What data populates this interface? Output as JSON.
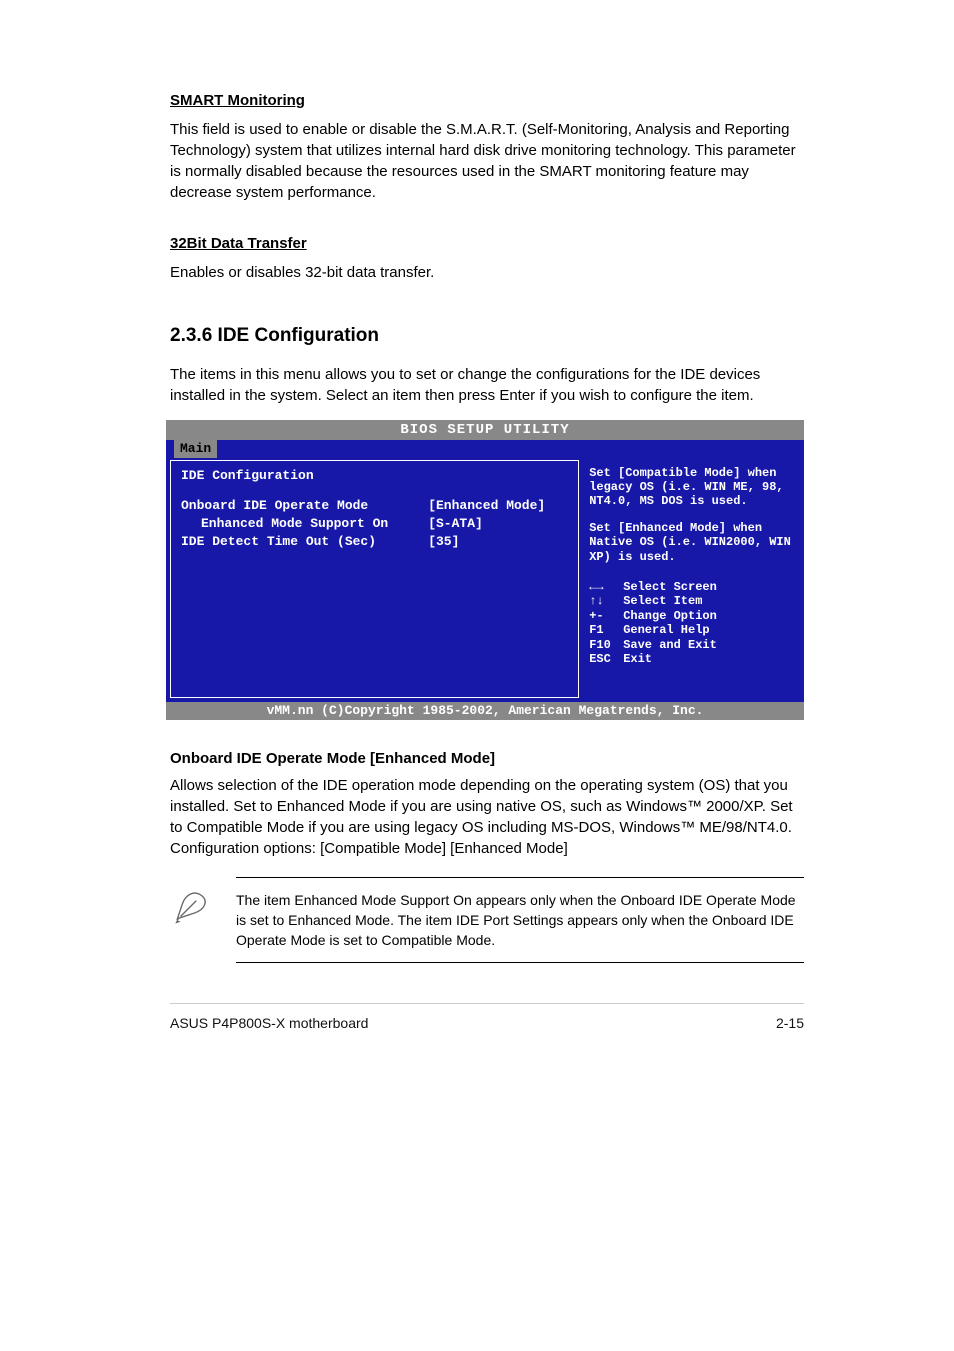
{
  "sections": {
    "smart": {
      "heading": "SMART Monitoring",
      "body": "This field is used to enable or disable the S.M.A.R.T. (Self-Monitoring, Analysis and Reporting Technology) system that utilizes internal hard disk drive monitoring technology. This parameter is normally disabled because the resources used in the SMART monitoring feature may decrease system performance."
    },
    "transfer": {
      "heading": "32Bit Data Transfer",
      "body": "Enables or disables 32-bit data transfer."
    },
    "ide_conf": {
      "title": "2.3.6 IDE Configuration",
      "intro": "The items in this menu allows you to set or change the configurations for the IDE devices installed in the system. Select an item then press Enter if you wish to configure the item."
    },
    "opmode": {
      "heading": "Onboard IDE Operate Mode [Enhanced Mode]",
      "body": "Allows selection of the IDE operation mode depending on the operating system (OS) that you installed. Set to Enhanced Mode if you are using native OS, such as Windows™ 2000/XP. Set to Compatible Mode if you are using legacy OS including MS-DOS, Windows™ ME/98/NT4.0. Configuration options: [Compatible Mode] [Enhanced Mode]"
    }
  },
  "bios": {
    "top": "BIOS SETUP UTILITY",
    "menubar": {
      "active": "Main"
    },
    "left_title": "IDE Configuration",
    "rows": {
      "r1": {
        "label": "Onboard IDE Operate Mode",
        "value": "[Enhanced Mode]"
      },
      "r2": {
        "label": "Enhanced Mode Support On",
        "value": "[S-ATA]"
      },
      "r3": {
        "label": "IDE Detect Time Out (Sec)",
        "value": "[35]"
      }
    },
    "help": {
      "p1": "Set [Compatible Mode] when legacy OS (i.e. WIN ME, 98, NT4.0, MS DOS is used.",
      "p2": "Set [Enhanced Mode] when Native OS (i.e. WIN2000, WIN XP) is used."
    },
    "nav": {
      "k1": "←→",
      "d1": "Select Screen",
      "k2": "↑↓",
      "d2": "Select Item",
      "k3": "+-",
      "d3": "Change Option",
      "k4": "F1",
      "d4": "General Help",
      "k5": "F10",
      "d5": "Save and Exit",
      "k6": "ESC",
      "d6": "Exit"
    },
    "footer": "vMM.nn (C)Copyright 1985-2002, American Megatrends, Inc."
  },
  "note": "The item Enhanced Mode Support On appears only when the Onboard IDE Operate Mode is set to Enhanced Mode. The item IDE Port Settings appears only when the Onboard IDE Operate Mode is set to Compatible Mode.",
  "footer": {
    "left": "ASUS P4P800S-X motherboard",
    "right": "2-15"
  }
}
